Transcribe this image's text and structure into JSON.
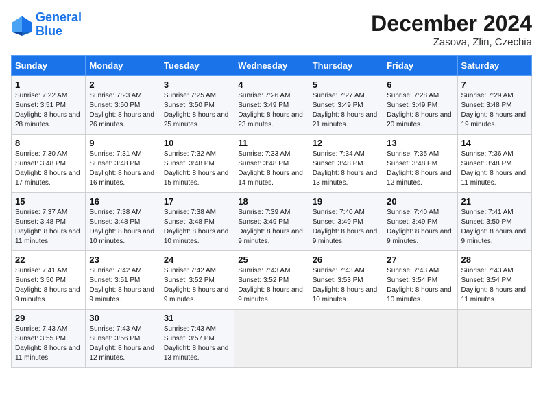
{
  "header": {
    "logo_line1": "General",
    "logo_line2": "Blue",
    "month_title": "December 2024",
    "location": "Zasova, Zlin, Czechia"
  },
  "weekdays": [
    "Sunday",
    "Monday",
    "Tuesday",
    "Wednesday",
    "Thursday",
    "Friday",
    "Saturday"
  ],
  "weeks": [
    [
      {
        "day": "1",
        "sunrise": "Sunrise: 7:22 AM",
        "sunset": "Sunset: 3:51 PM",
        "daylight": "Daylight: 8 hours and 28 minutes."
      },
      {
        "day": "2",
        "sunrise": "Sunrise: 7:23 AM",
        "sunset": "Sunset: 3:50 PM",
        "daylight": "Daylight: 8 hours and 26 minutes."
      },
      {
        "day": "3",
        "sunrise": "Sunrise: 7:25 AM",
        "sunset": "Sunset: 3:50 PM",
        "daylight": "Daylight: 8 hours and 25 minutes."
      },
      {
        "day": "4",
        "sunrise": "Sunrise: 7:26 AM",
        "sunset": "Sunset: 3:49 PM",
        "daylight": "Daylight: 8 hours and 23 minutes."
      },
      {
        "day": "5",
        "sunrise": "Sunrise: 7:27 AM",
        "sunset": "Sunset: 3:49 PM",
        "daylight": "Daylight: 8 hours and 21 minutes."
      },
      {
        "day": "6",
        "sunrise": "Sunrise: 7:28 AM",
        "sunset": "Sunset: 3:49 PM",
        "daylight": "Daylight: 8 hours and 20 minutes."
      },
      {
        "day": "7",
        "sunrise": "Sunrise: 7:29 AM",
        "sunset": "Sunset: 3:48 PM",
        "daylight": "Daylight: 8 hours and 19 minutes."
      }
    ],
    [
      {
        "day": "8",
        "sunrise": "Sunrise: 7:30 AM",
        "sunset": "Sunset: 3:48 PM",
        "daylight": "Daylight: 8 hours and 17 minutes."
      },
      {
        "day": "9",
        "sunrise": "Sunrise: 7:31 AM",
        "sunset": "Sunset: 3:48 PM",
        "daylight": "Daylight: 8 hours and 16 minutes."
      },
      {
        "day": "10",
        "sunrise": "Sunrise: 7:32 AM",
        "sunset": "Sunset: 3:48 PM",
        "daylight": "Daylight: 8 hours and 15 minutes."
      },
      {
        "day": "11",
        "sunrise": "Sunrise: 7:33 AM",
        "sunset": "Sunset: 3:48 PM",
        "daylight": "Daylight: 8 hours and 14 minutes."
      },
      {
        "day": "12",
        "sunrise": "Sunrise: 7:34 AM",
        "sunset": "Sunset: 3:48 PM",
        "daylight": "Daylight: 8 hours and 13 minutes."
      },
      {
        "day": "13",
        "sunrise": "Sunrise: 7:35 AM",
        "sunset": "Sunset: 3:48 PM",
        "daylight": "Daylight: 8 hours and 12 minutes."
      },
      {
        "day": "14",
        "sunrise": "Sunrise: 7:36 AM",
        "sunset": "Sunset: 3:48 PM",
        "daylight": "Daylight: 8 hours and 11 minutes."
      }
    ],
    [
      {
        "day": "15",
        "sunrise": "Sunrise: 7:37 AM",
        "sunset": "Sunset: 3:48 PM",
        "daylight": "Daylight: 8 hours and 11 minutes."
      },
      {
        "day": "16",
        "sunrise": "Sunrise: 7:38 AM",
        "sunset": "Sunset: 3:48 PM",
        "daylight": "Daylight: 8 hours and 10 minutes."
      },
      {
        "day": "17",
        "sunrise": "Sunrise: 7:38 AM",
        "sunset": "Sunset: 3:48 PM",
        "daylight": "Daylight: 8 hours and 10 minutes."
      },
      {
        "day": "18",
        "sunrise": "Sunrise: 7:39 AM",
        "sunset": "Sunset: 3:49 PM",
        "daylight": "Daylight: 8 hours and 9 minutes."
      },
      {
        "day": "19",
        "sunrise": "Sunrise: 7:40 AM",
        "sunset": "Sunset: 3:49 PM",
        "daylight": "Daylight: 8 hours and 9 minutes."
      },
      {
        "day": "20",
        "sunrise": "Sunrise: 7:40 AM",
        "sunset": "Sunset: 3:49 PM",
        "daylight": "Daylight: 8 hours and 9 minutes."
      },
      {
        "day": "21",
        "sunrise": "Sunrise: 7:41 AM",
        "sunset": "Sunset: 3:50 PM",
        "daylight": "Daylight: 8 hours and 9 minutes."
      }
    ],
    [
      {
        "day": "22",
        "sunrise": "Sunrise: 7:41 AM",
        "sunset": "Sunset: 3:50 PM",
        "daylight": "Daylight: 8 hours and 9 minutes."
      },
      {
        "day": "23",
        "sunrise": "Sunrise: 7:42 AM",
        "sunset": "Sunset: 3:51 PM",
        "daylight": "Daylight: 8 hours and 9 minutes."
      },
      {
        "day": "24",
        "sunrise": "Sunrise: 7:42 AM",
        "sunset": "Sunset: 3:52 PM",
        "daylight": "Daylight: 8 hours and 9 minutes."
      },
      {
        "day": "25",
        "sunrise": "Sunrise: 7:43 AM",
        "sunset": "Sunset: 3:52 PM",
        "daylight": "Daylight: 8 hours and 9 minutes."
      },
      {
        "day": "26",
        "sunrise": "Sunrise: 7:43 AM",
        "sunset": "Sunset: 3:53 PM",
        "daylight": "Daylight: 8 hours and 10 minutes."
      },
      {
        "day": "27",
        "sunrise": "Sunrise: 7:43 AM",
        "sunset": "Sunset: 3:54 PM",
        "daylight": "Daylight: 8 hours and 10 minutes."
      },
      {
        "day": "28",
        "sunrise": "Sunrise: 7:43 AM",
        "sunset": "Sunset: 3:54 PM",
        "daylight": "Daylight: 8 hours and 11 minutes."
      }
    ],
    [
      {
        "day": "29",
        "sunrise": "Sunrise: 7:43 AM",
        "sunset": "Sunset: 3:55 PM",
        "daylight": "Daylight: 8 hours and 11 minutes."
      },
      {
        "day": "30",
        "sunrise": "Sunrise: 7:43 AM",
        "sunset": "Sunset: 3:56 PM",
        "daylight": "Daylight: 8 hours and 12 minutes."
      },
      {
        "day": "31",
        "sunrise": "Sunrise: 7:43 AM",
        "sunset": "Sunset: 3:57 PM",
        "daylight": "Daylight: 8 hours and 13 minutes."
      },
      null,
      null,
      null,
      null
    ]
  ]
}
